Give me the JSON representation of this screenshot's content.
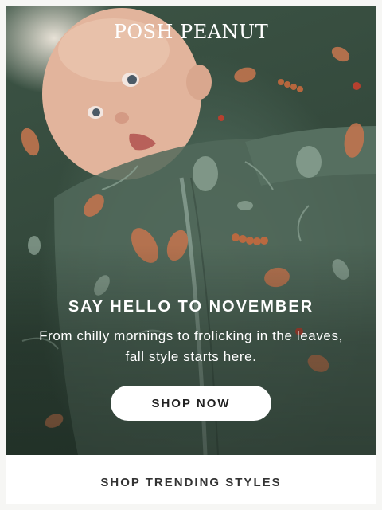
{
  "brand": {
    "logo_text": "POSH PEANUT"
  },
  "hero": {
    "image_subject": "baby-in-fall-print-footie",
    "headline": "SAY HELLO TO NOVEMBER",
    "subtext": "From chilly mornings to frolicking in the leaves, fall style starts here.",
    "cta_label": "SHOP NOW"
  },
  "section": {
    "title": "SHOP TRENDING STYLES"
  },
  "colors": {
    "fabric": "#465f51",
    "cta_background": "#ffffff",
    "cta_text": "#222222",
    "section_text": "#333333"
  }
}
